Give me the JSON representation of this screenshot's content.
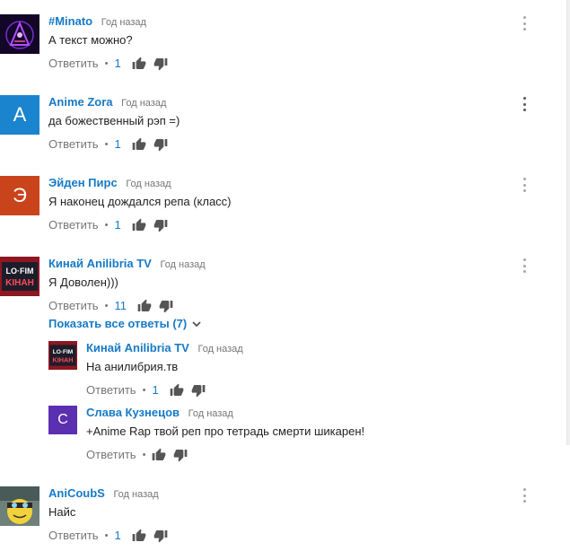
{
  "reply_label": "Ответить",
  "separator": "•",
  "colors": {
    "link": "#167ac6",
    "muted": "#767676",
    "thumb": "#555555"
  },
  "icons": {
    "like": "thumb-up-icon",
    "dislike": "thumb-down-icon",
    "menu": "more-vert-icon",
    "expand": "chevron-down-icon"
  },
  "comments": [
    {
      "author": "#Minato",
      "time": "Год назад",
      "text": "А текст можно?",
      "likes": "1",
      "avatar_letter": "",
      "avatar_color": "#14092a"
    },
    {
      "author": "Anime Zora",
      "time": "Год назад",
      "text": "да божественный рэп =)",
      "likes": "1",
      "avatar_letter": "А",
      "avatar_color": "#1a84cf"
    },
    {
      "author": "Эйден Пирс",
      "time": "Год назад",
      "text": "Я наконец дождался репа (класс)",
      "likes": "1",
      "avatar_letter": "Э",
      "avatar_color": "#c9441b"
    },
    {
      "author": "Кинай Anilibria TV",
      "time": "Год назад",
      "text": "Я Доволен)))",
      "likes": "11",
      "avatar_letter": "",
      "avatar_color": "#a01d27"
    },
    {
      "author": "AniCoubS",
      "time": "Год назад",
      "text": "Найс",
      "likes": "1",
      "avatar_letter": "",
      "avatar_color": "#7b8a86"
    }
  ],
  "show_replies": "Показать все ответы (7)",
  "replies": [
    {
      "author": "Кинай Anilibria TV",
      "time": "Год назад",
      "text": "На анилибрия.тв",
      "likes": "1",
      "avatar_letter": "",
      "avatar_color": "#a01d27"
    },
    {
      "author": "Слава Кузнецов",
      "time": "Год назад",
      "text": "+Anime Rap твой реп про тетрадь смерти шикарен!",
      "likes": "",
      "avatar_letter": "С",
      "avatar_color": "#5a2fb0"
    }
  ]
}
